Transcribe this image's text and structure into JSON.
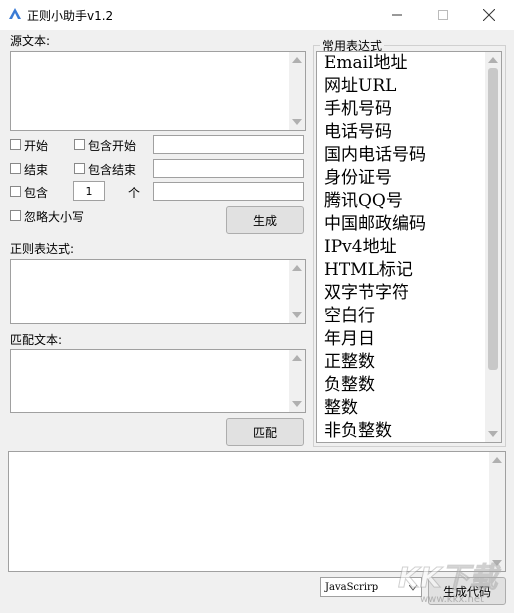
{
  "window": {
    "title": "正则小助手v1.2"
  },
  "source": {
    "label": "源文本:"
  },
  "options": {
    "start_label": "开始",
    "contains_start_label": "包含开始",
    "end_label": "结束",
    "contains_end_label": "包含结束",
    "contains_label": "包含",
    "count_value": "1",
    "count_unit": "个",
    "ignore_case_label": "忽略大小写"
  },
  "buttons": {
    "generate": "生成",
    "match": "匹配",
    "generate_code": "生成代码"
  },
  "regex": {
    "label": "正则表达式:"
  },
  "match_text": {
    "label": "匹配文本:"
  },
  "common": {
    "label": "常用表达式",
    "items": [
      "Email地址",
      "网址URL",
      "手机号码",
      "电话号码",
      "国内电话号码",
      "身份证号",
      "腾讯QQ号",
      "中国邮政编码",
      "IPv4地址",
      "HTML标记",
      "双字节字符",
      "空白行",
      "年月日",
      "正整数",
      "负整数",
      "整数",
      "非负整数"
    ]
  },
  "language": {
    "value": "JavaScrirp"
  },
  "watermark": {
    "text": "KK下载",
    "url": "www.kkx.net"
  }
}
